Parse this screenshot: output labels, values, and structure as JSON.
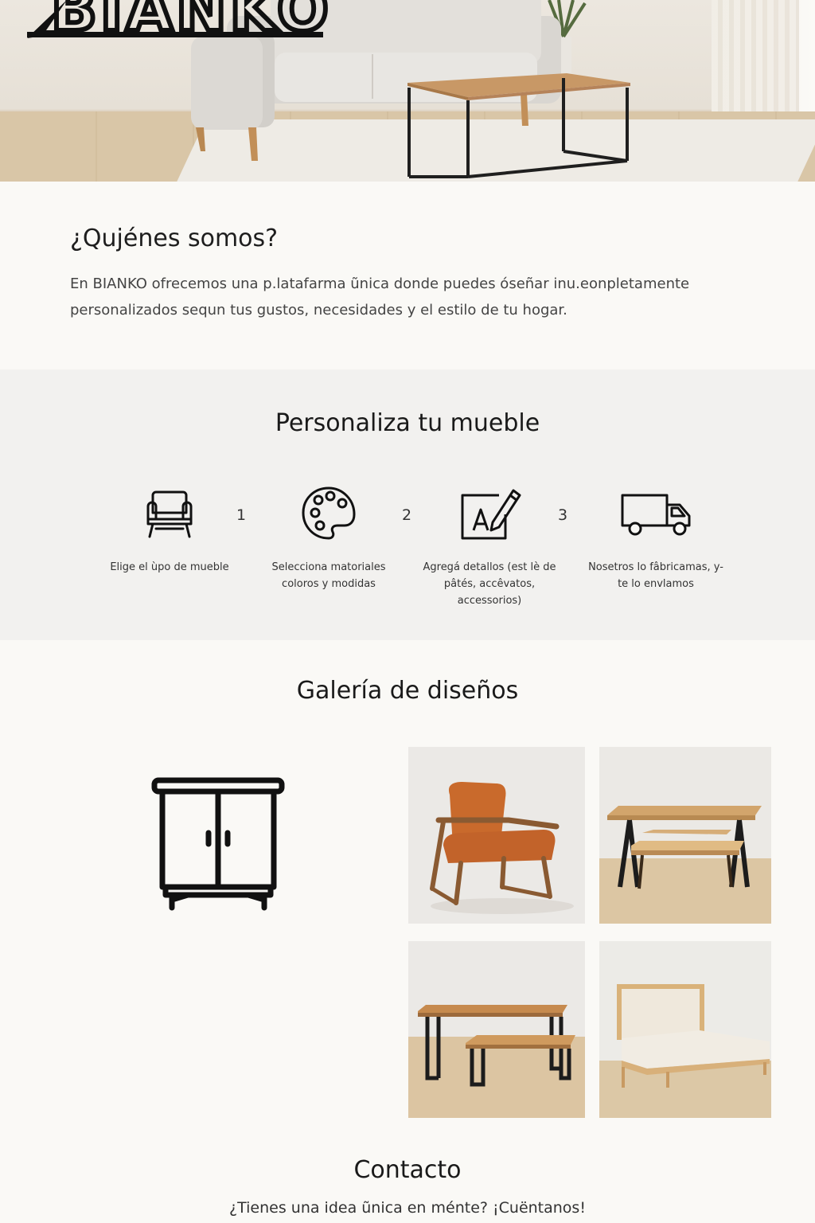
{
  "brand": {
    "logo_text": "BIANKO"
  },
  "about": {
    "title": "¿Qujénes somos?",
    "text": "En BIANKO ofrecemos una p.latafarma ũnica donde puedes óseñar inu.eonpletamente personalizados sequn tus gustos, necesidades y el estilo de tu hogar."
  },
  "personalize": {
    "title": "Personaliza tu mueble",
    "steps": [
      {
        "icon": "armchair-icon",
        "caption": "Elige el ùpo de mueble"
      },
      {
        "icon": "palette-icon",
        "caption": "Selecciona matoriales coloros y modidas"
      },
      {
        "icon": "edit-text-icon",
        "caption": "Agregá detallos (est lè de pâtés, accêvatos, accessorios)"
      },
      {
        "icon": "truck-icon",
        "caption": "Nosetros lo fâbricamas, y-te lo envlamos"
      }
    ],
    "numbers": [
      "1",
      "2",
      "3"
    ]
  },
  "gallery": {
    "title": "Galería de diseños",
    "items": [
      {
        "icon": "wardrobe-icon"
      },
      {
        "icon": "orange-armchair-photo"
      },
      {
        "icon": "dining-table-bench-photo"
      },
      {
        "icon": "table-with-bench-photo"
      },
      {
        "icon": "bed-photo"
      }
    ]
  },
  "contact": {
    "title": "Contacto",
    "text": "¿Tienes una idea ũnica en ménte? ¡Cuëntanos!"
  },
  "colors": {
    "background": "#faf9f6",
    "section_alt": "#f2f1ef",
    "text": "#1e1e1e",
    "wood": "#c9925a",
    "upholstery_orange": "#c96a2c"
  }
}
